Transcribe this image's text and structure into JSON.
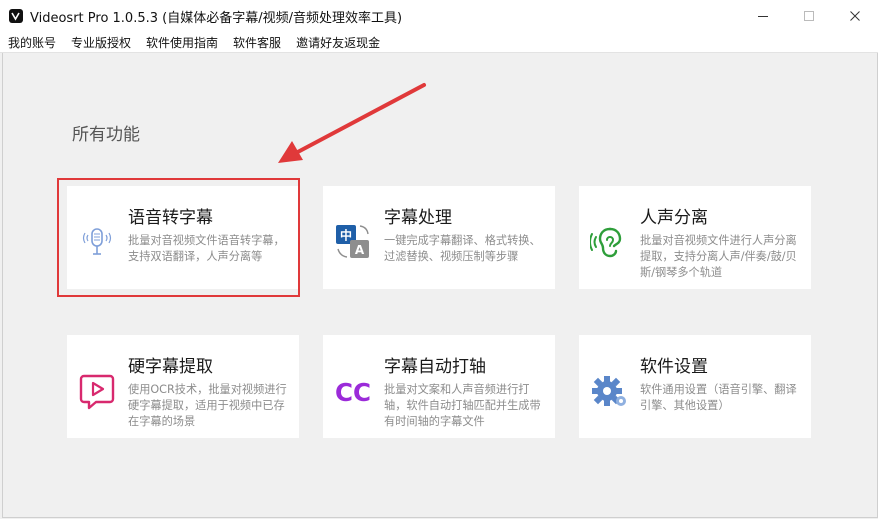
{
  "window": {
    "title": "Videosrt Pro 1.0.5.3  (自媒体必备字幕/视频/音频处理效率工具)"
  },
  "menu": [
    "我的账号",
    "专业版授权",
    "软件使用指南",
    "软件客服",
    "邀请好友返现金"
  ],
  "section_title": "所有功能",
  "cards": [
    {
      "title": "语音转字幕",
      "desc": "批量对音视频文件语音转字幕，支持双语翻译，人声分离等",
      "icon": "microphone-icon"
    },
    {
      "title": "字幕处理",
      "desc": "一键完成字幕翻译、格式转换、过滤替换、视频压制等步骤",
      "icon": "translate-icon",
      "icon_text_1": "中",
      "icon_text_2": "A"
    },
    {
      "title": "人声分离",
      "desc": "批量对音视频文件进行人声分离提取，支持分离人声/伴奏/鼓/贝斯/钢琴多个轨道",
      "icon": "ear-sound-icon"
    },
    {
      "title": "硬字幕提取",
      "desc": "使用OCR技术，批量对视频进行硬字幕提取，适用于视频中已存在字幕的场景",
      "icon": "video-play-icon"
    },
    {
      "title": "字幕自动打轴",
      "desc": "批量对文案和人声音频进行打轴，软件自动打轴匹配并生成带有时间轴的字幕文件",
      "icon": "closed-caption-icon",
      "icon_text": "CC"
    },
    {
      "title": "软件设置",
      "desc": "软件通用设置（语音引擎、翻译引擎、其他设置）",
      "icon": "gear-icon"
    }
  ],
  "colors": {
    "highlight": "#e0393a",
    "mic": "#7f9fd9",
    "cc": "#9b2bd9",
    "ear": "#2e9e3a",
    "video": "#d8296e",
    "gear": "#5a86c9"
  }
}
